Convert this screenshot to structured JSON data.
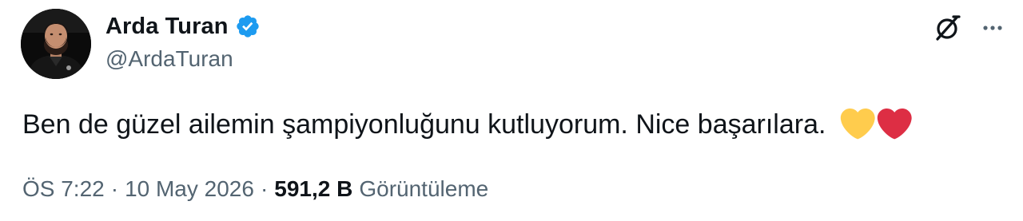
{
  "author": {
    "display_name": "Arda Turan",
    "handle": "@ArdaTuran",
    "verified": true
  },
  "tweet": {
    "text": "Ben de güzel ailemin şampiyonluğunu kutluyorum. Nice başarılara.",
    "emojis": [
      "yellow-heart",
      "red-heart"
    ]
  },
  "meta": {
    "time": "ÖS 7:22",
    "separator": "·",
    "date": "10 May 2026",
    "views_count": "591,2 B",
    "views_label": "Görüntüleme"
  },
  "icons": {
    "verified": "verified-badge-icon",
    "grok": "grok-icon",
    "more": "more-options-icon"
  },
  "colors": {
    "verified_blue": "#1d9bf0",
    "secondary_text": "#536471",
    "primary_text": "#0f1419",
    "yellow_heart": "#ffcc4d",
    "red_heart": "#dd2e44"
  }
}
